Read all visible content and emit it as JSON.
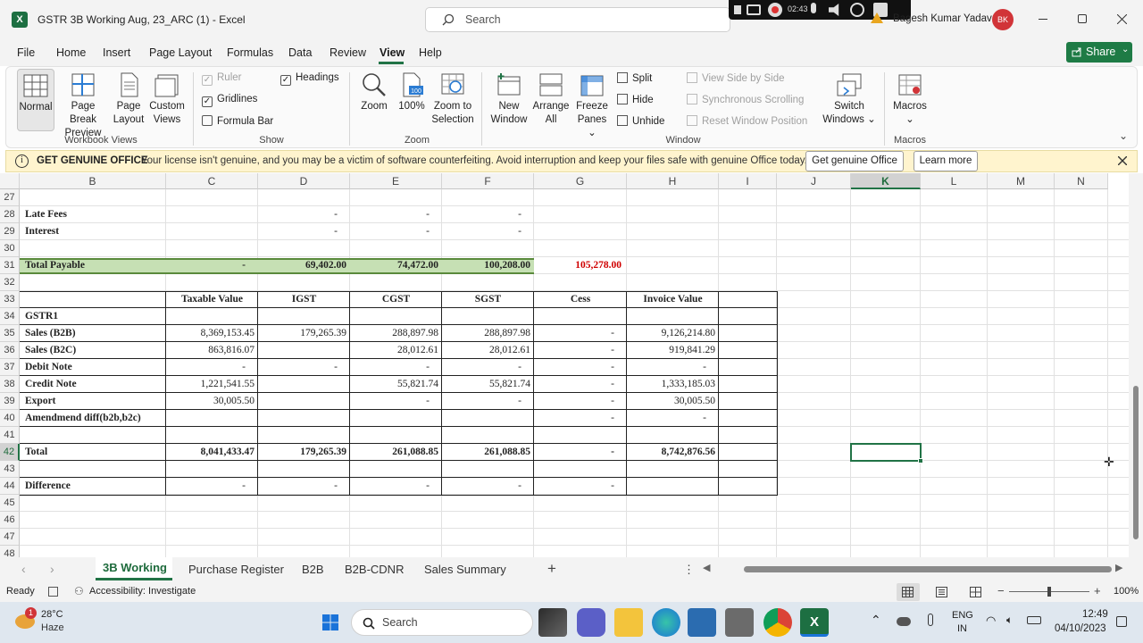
{
  "title": {
    "filename": "GSTR 3B Working Aug, 23_ARC (1)",
    "sep": "-",
    "app": "Excel",
    "search_placeholder": "Search",
    "user": "Bagesh Kumar Yadav",
    "initials": "BK",
    "recorder_time": "02:43"
  },
  "menu": [
    "File",
    "Home",
    "Insert",
    "Page Layout",
    "Formulas",
    "Data",
    "Review",
    "View",
    "Help"
  ],
  "share_label": "Share",
  "ribbon": {
    "workbook_views": {
      "normal": "Normal",
      "page_break": [
        "Page Break",
        "Preview"
      ],
      "page_layout": [
        "Page",
        "Layout"
      ],
      "custom": [
        "Custom",
        "Views"
      ],
      "group": "Workbook Views"
    },
    "show": {
      "ruler": "Ruler",
      "gridlines": "Gridlines",
      "formula_bar": "Formula Bar",
      "headings": "Headings",
      "group": "Show"
    },
    "zoom": {
      "zoom": "Zoom",
      "hundred": "100%",
      "zoom_sel": [
        "Zoom to",
        "Selection"
      ],
      "group": "Zoom"
    },
    "window": {
      "new": [
        "New",
        "Window"
      ],
      "arrange": [
        "Arrange",
        "All"
      ],
      "freeze": [
        "Freeze",
        "Panes"
      ],
      "split": "Split",
      "hide": "Hide",
      "unhide": "Unhide",
      "side": "View Side by Side",
      "sync": "Synchronous Scrolling",
      "reset": "Reset Window Position",
      "switch": [
        "Switch",
        "Windows"
      ],
      "group": "Window"
    },
    "macros": {
      "label": "Macros",
      "group": "Macros"
    }
  },
  "message": {
    "title": "GET GENUINE OFFICE",
    "text": "Your license isn't genuine, and you may be a victim of software counterfeiting. Avoid interruption and keep your files safe with genuine Office today.",
    "btn1": "Get genuine Office",
    "btn2": "Learn more"
  },
  "columns": [
    "B",
    "C",
    "D",
    "E",
    "F",
    "G",
    "H",
    "I",
    "J",
    "K",
    "L",
    "M",
    "N"
  ],
  "rows": [
    {
      "n": "27",
      "cells": [
        "",
        "",
        "",
        "",
        "",
        "",
        "",
        ""
      ]
    },
    {
      "n": "28",
      "cells": [
        "Late Fees",
        "",
        "-",
        "-",
        "-",
        "",
        "",
        ""
      ]
    },
    {
      "n": "29",
      "cells": [
        "Interest",
        "",
        "-",
        "-",
        "-",
        "",
        "",
        ""
      ]
    },
    {
      "n": "30",
      "cells": [
        "",
        "",
        "",
        "",
        "",
        "",
        "",
        ""
      ]
    },
    {
      "n": "31",
      "cells": [
        "Total Payable",
        "-",
        "69,402.00",
        "74,472.00",
        "100,208.00",
        "105,278.00",
        "",
        ""
      ]
    },
    {
      "n": "32",
      "cells": [
        "",
        "",
        "",
        "",
        "",
        "",
        "",
        ""
      ]
    },
    {
      "n": "33",
      "cells": [
        "",
        "Taxable Value",
        "IGST",
        "CGST",
        "SGST",
        "Cess",
        "Invoice Value",
        ""
      ]
    },
    {
      "n": "34",
      "cells": [
        "GSTR1",
        "",
        "",
        "",
        "",
        "",
        "",
        ""
      ]
    },
    {
      "n": "35",
      "cells": [
        "Sales (B2B)",
        "8,369,153.45",
        "179,265.39",
        "288,897.98",
        "288,897.98",
        "-",
        "9,126,214.80",
        ""
      ]
    },
    {
      "n": "36",
      "cells": [
        "Sales (B2C)",
        "863,816.07",
        "",
        "28,012.61",
        "28,012.61",
        "-",
        "919,841.29",
        ""
      ]
    },
    {
      "n": "37",
      "cells": [
        "Debit Note",
        "-",
        "-",
        "-",
        "-",
        "-",
        "-",
        ""
      ]
    },
    {
      "n": "38",
      "cells": [
        "Credit Note",
        "1,221,541.55",
        "",
        "55,821.74",
        "55,821.74",
        "-",
        "1,333,185.03",
        ""
      ]
    },
    {
      "n": "39",
      "cells": [
        "Export",
        "30,005.50",
        "",
        "-",
        "-",
        "-",
        "30,005.50",
        ""
      ]
    },
    {
      "n": "40",
      "cells": [
        "Amendmend diff(b2b,b2c)",
        "",
        "",
        "",
        "",
        "-",
        "-",
        ""
      ]
    },
    {
      "n": "41",
      "cells": [
        "",
        "",
        "",
        "",
        "",
        "",
        "",
        ""
      ]
    },
    {
      "n": "42",
      "cells": [
        "Total",
        "8,041,433.47",
        "179,265.39",
        "261,088.85",
        "261,088.85",
        "-",
        "8,742,876.56",
        ""
      ]
    },
    {
      "n": "43",
      "cells": [
        "",
        "",
        "",
        "",
        "",
        "",
        "",
        ""
      ]
    },
    {
      "n": "44",
      "cells": [
        "Difference",
        "-",
        "-",
        "-",
        "-",
        "-",
        "",
        ""
      ]
    },
    {
      "n": "45",
      "cells": [
        "",
        "",
        "",
        "",
        "",
        "",
        "",
        ""
      ]
    },
    {
      "n": "46",
      "cells": [
        "",
        "",
        "",
        "",
        "",
        "",
        "",
        ""
      ]
    },
    {
      "n": "47",
      "cells": [
        "",
        "",
        "",
        "",
        "",
        "",
        "",
        ""
      ]
    },
    {
      "n": "48",
      "cells": [
        "",
        "",
        "",
        "",
        "",
        "",
        "",
        ""
      ]
    }
  ],
  "sheets": [
    "3B Working",
    "Purchase Register",
    "B2B",
    "B2B-CDNR",
    "Sales Summary"
  ],
  "status": {
    "ready": "Ready",
    "accessibility": "Accessibility: Investigate",
    "zoom": "100%"
  },
  "taskbar": {
    "temp": "28°C",
    "weather": "Haze",
    "badge": "1",
    "search": "Search",
    "lang1": "ENG",
    "lang2": "IN",
    "time": "12:49",
    "date": "04/10/2023"
  },
  "colors": {
    "excel_green": "#217346",
    "total_payable_fill": "#c6e0b4",
    "red_value": "#d00000",
    "share_green": "#1e7b45"
  }
}
